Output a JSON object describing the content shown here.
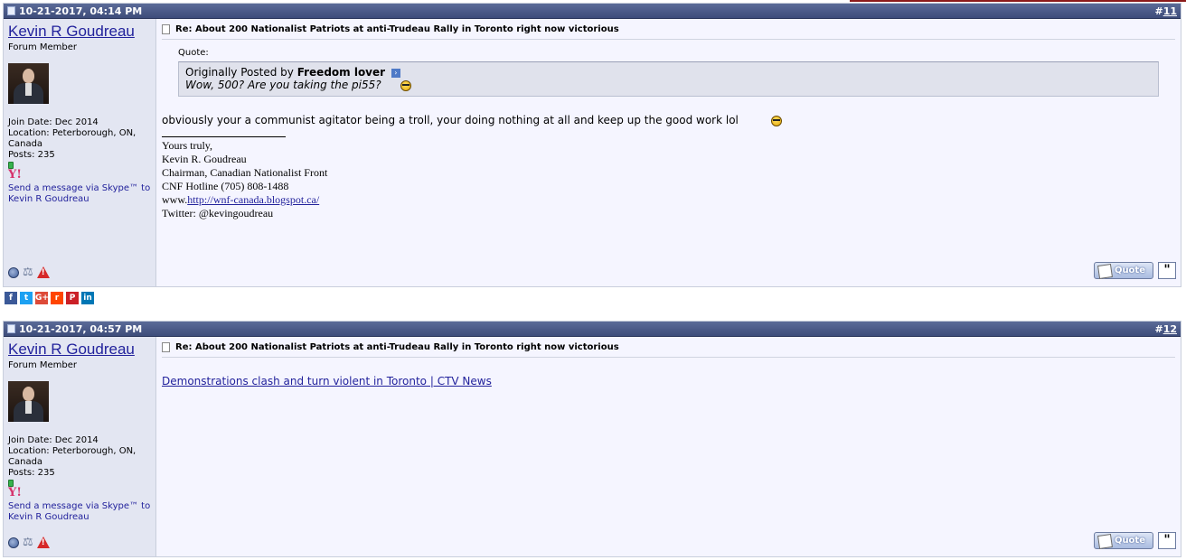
{
  "posts": [
    {
      "date": "10-21-2017, 04:14 PM",
      "number_prefix": "#",
      "number": "11",
      "user": {
        "name": "Kevin R Goudreau",
        "title": "Forum Member",
        "join_date": "Join Date: Dec 2014",
        "location": "Location: Peterborough, ON, Canada",
        "posts": "Posts: 235",
        "skype": "Send a message via Skype™ to Kevin R Goudreau"
      },
      "title": "Re: About 200 Nationalist Patriots at anti-Trudeau Rally in Toronto right now victorious",
      "quote_label": "Quote:",
      "quote_prefix": "Originally Posted by",
      "quote_author": "Freedom lover",
      "quote_text": "Wow, 500? Are you taking the pi55?",
      "message": "obviously your a communist agitator being a troll, your doing nothing at all and keep up the good work lol",
      "signature": {
        "line1": "Yours truly,",
        "line2": "Kevin R. Goudreau",
        "line3": "Chairman, Canadian Nationalist Front",
        "line4": "CNF Hotline (705) 808-1488",
        "www_prefix": "www.",
        "link": "http://wnf-canada.blogspot.ca/",
        "line6": "Twitter: @kevingoudreau"
      },
      "quote_button": "Quote"
    },
    {
      "date": "10-21-2017, 04:57 PM",
      "number_prefix": "#",
      "number": "12",
      "user": {
        "name": "Kevin R Goudreau",
        "title": "Forum Member",
        "join_date": "Join Date: Dec 2014",
        "location": "Location: Peterborough, ON, Canada",
        "posts": "Posts: 235",
        "skype": "Send a message via Skype™ to Kevin R Goudreau"
      },
      "title": "Re: About 200 Nationalist Patriots at anti-Trudeau Rally in Toronto right now victorious",
      "link_text": "Demonstrations clash and turn violent in Toronto | CTV News",
      "quote_button": "Quote"
    }
  ],
  "share": {
    "facebook": "f",
    "twitter": "t",
    "google": "G+",
    "reddit": "r",
    "pinterest": "P",
    "linkedin": "in",
    "colors": {
      "facebook": "#3b5998",
      "twitter": "#1da1f2",
      "google": "#dd4b39",
      "reddit": "#ff4500",
      "pinterest": "#cb2027",
      "linkedin": "#0077b5"
    }
  },
  "icons": {
    "post_header": "document-icon",
    "user_icons": [
      "profile-icon",
      "reputation-icon",
      "report-icon"
    ],
    "status": "online-status-icon",
    "yahoo": "yahoo-icon",
    "multiquote": "multiquote-icon"
  }
}
